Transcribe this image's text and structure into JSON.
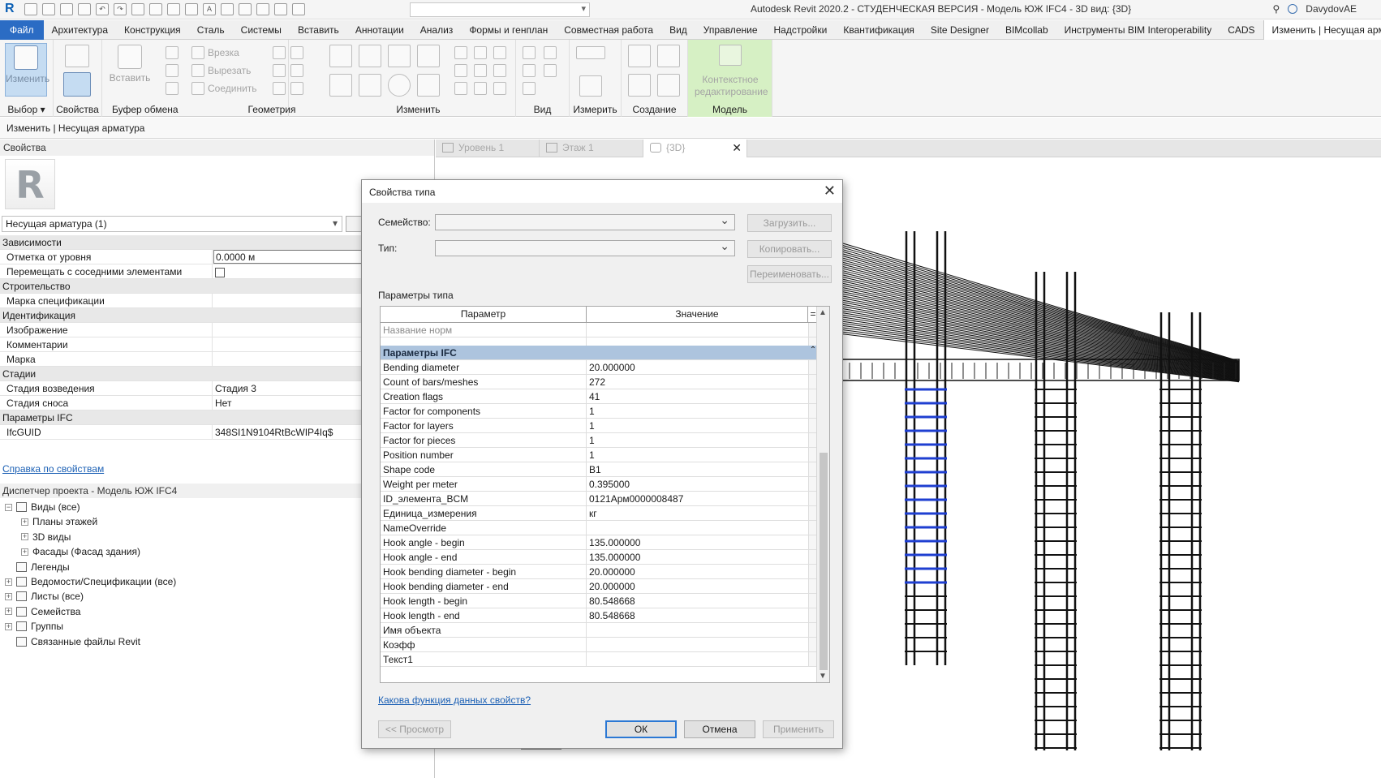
{
  "window": {
    "title": "Autodesk Revit 2020.2 - СТУДЕНЧЕСКАЯ ВЕРСИЯ - Модель ЮЖ IFC4 - 3D вид: {3D}",
    "user": "DavydovAE"
  },
  "ribbon": {
    "tabs": [
      "Файл",
      "Архитектура",
      "Конструкция",
      "Сталь",
      "Системы",
      "Вставить",
      "Аннотации",
      "Анализ",
      "Формы и генплан",
      "Совместная работа",
      "Вид",
      "Управление",
      "Надстройки",
      "Квантификация",
      "Site Designer",
      "BIMcollab",
      "Инструменты BIM Interoperability",
      "CADS",
      "Изменить | Несущая армату"
    ],
    "groups": {
      "select": "Выбор",
      "properties": "Свойства",
      "clipboard": "Буфер обмена",
      "geometry": "Геометрия",
      "modify": "Изменить",
      "view": "Вид",
      "measure": "Измерить",
      "create": "Создание",
      "model": "Модель"
    },
    "buttons": {
      "modify": "Изменить",
      "paste": "Вставить",
      "cope": "Врезка",
      "cut": "Вырезать",
      "join": "Соединить",
      "context_edit_1": "Контекстное",
      "context_edit_2": "редактирование"
    }
  },
  "options_bar": {
    "label": "Изменить | Несущая арматура"
  },
  "properties": {
    "header": "Свойства",
    "type_selector": "Несущая арматура (1)",
    "rows": [
      {
        "cat": true,
        "k": "Зависимости",
        "v": ""
      },
      {
        "k": "Отметка от уровня",
        "v": "0.0000 м",
        "edit": true
      },
      {
        "k": "Перемещать с соседними элементами",
        "v": "",
        "check": true
      },
      {
        "cat": true,
        "k": "Строительство",
        "v": ""
      },
      {
        "k": "Марка спецификации",
        "v": ""
      },
      {
        "cat": true,
        "k": "Идентификация",
        "v": ""
      },
      {
        "k": "Изображение",
        "v": ""
      },
      {
        "k": "Комментарии",
        "v": ""
      },
      {
        "k": "Марка",
        "v": ""
      },
      {
        "cat": true,
        "k": "Стадии",
        "v": ""
      },
      {
        "k": "Стадия возведения",
        "v": "Стадия 3"
      },
      {
        "k": "Стадия сноса",
        "v": "Нет"
      },
      {
        "cat": true,
        "k": "Параметры IFC",
        "v": ""
      },
      {
        "k": "IfcGUID",
        "v": "348SI1N9104RtBcWIP4Iq$"
      }
    ],
    "help_link": "Справка по свойствам"
  },
  "browser": {
    "header": "Диспетчер проекта - Модель ЮЖ IFC4",
    "items": [
      {
        "label": "Виды (все)",
        "level": 0,
        "pm": "−"
      },
      {
        "label": "Планы этажей",
        "level": 1,
        "pm": "+"
      },
      {
        "label": "3D виды",
        "level": 1,
        "pm": "+"
      },
      {
        "label": "Фасады (Фасад здания)",
        "level": 1,
        "pm": "+"
      },
      {
        "label": "Легенды",
        "level": 0,
        "pm": ""
      },
      {
        "label": "Ведомости/Спецификации (все)",
        "level": 0,
        "pm": "+"
      },
      {
        "label": "Листы (все)",
        "level": 0,
        "pm": "+"
      },
      {
        "label": "Семейства",
        "level": 0,
        "pm": "+"
      },
      {
        "label": "Группы",
        "level": 0,
        "pm": "+"
      },
      {
        "label": "Связанные файлы Revit",
        "level": 0,
        "pm": ""
      }
    ]
  },
  "view_tabs": [
    "Уровень 1",
    "Этаж 1",
    "{3D}"
  ],
  "dialog": {
    "title": "Свойства типа",
    "family_label": "Семейство:",
    "type_label": "Тип:",
    "load_btn": "Загрузить...",
    "copy_btn": "Копировать...",
    "rename_btn": "Переименовать...",
    "params_label": "Параметры типа",
    "col_param": "Параметр",
    "col_value": "Значение",
    "col_menu": "=",
    "rows": [
      {
        "k": "Название норм",
        "v": "",
        "grey": true
      },
      {
        "k": "",
        "v": "",
        "spacer": true
      },
      {
        "k": "Параметры IFC",
        "v": "",
        "group": true
      },
      {
        "k": "Bending diameter",
        "v": "20.000000"
      },
      {
        "k": "Count of bars/meshes",
        "v": "272"
      },
      {
        "k": "Creation flags",
        "v": "41"
      },
      {
        "k": "Factor for components",
        "v": "1"
      },
      {
        "k": "Factor for layers",
        "v": "1"
      },
      {
        "k": "Factor for pieces",
        "v": "1"
      },
      {
        "k": "Position number",
        "v": "1"
      },
      {
        "k": "Shape code",
        "v": "B1"
      },
      {
        "k": "Weight per meter",
        "v": "0.395000"
      },
      {
        "k": "ID_элемента_BCM",
        "v": "0121Арм0000008487"
      },
      {
        "k": "Единица_измерения",
        "v": "кг"
      },
      {
        "k": "NameOverride",
        "v": ""
      },
      {
        "k": "Hook angle - begin",
        "v": "135.000000"
      },
      {
        "k": "Hook angle - end",
        "v": "135.000000"
      },
      {
        "k": "Hook bending diameter - begin",
        "v": "20.000000"
      },
      {
        "k": "Hook bending diameter - end",
        "v": "20.000000"
      },
      {
        "k": "Hook length - begin",
        "v": "80.548668"
      },
      {
        "k": "Hook length - end",
        "v": "80.548668"
      },
      {
        "k": "Имя объекта",
        "v": ""
      },
      {
        "k": "Коэфф",
        "v": ""
      },
      {
        "k": "Текст1",
        "v": ""
      }
    ],
    "help_link": "Какова функция данных свойств?",
    "preview_btn": "<< Просмотр",
    "ok_btn": "ОК",
    "cancel_btn": "Отмена",
    "apply_btn": "Применить"
  },
  "colors": {
    "file_tab": "#2b6cc4",
    "model_group": "#d6f0c4",
    "ifc_group": "#adc4de",
    "stirrup_blue": "#1f3fd1"
  }
}
